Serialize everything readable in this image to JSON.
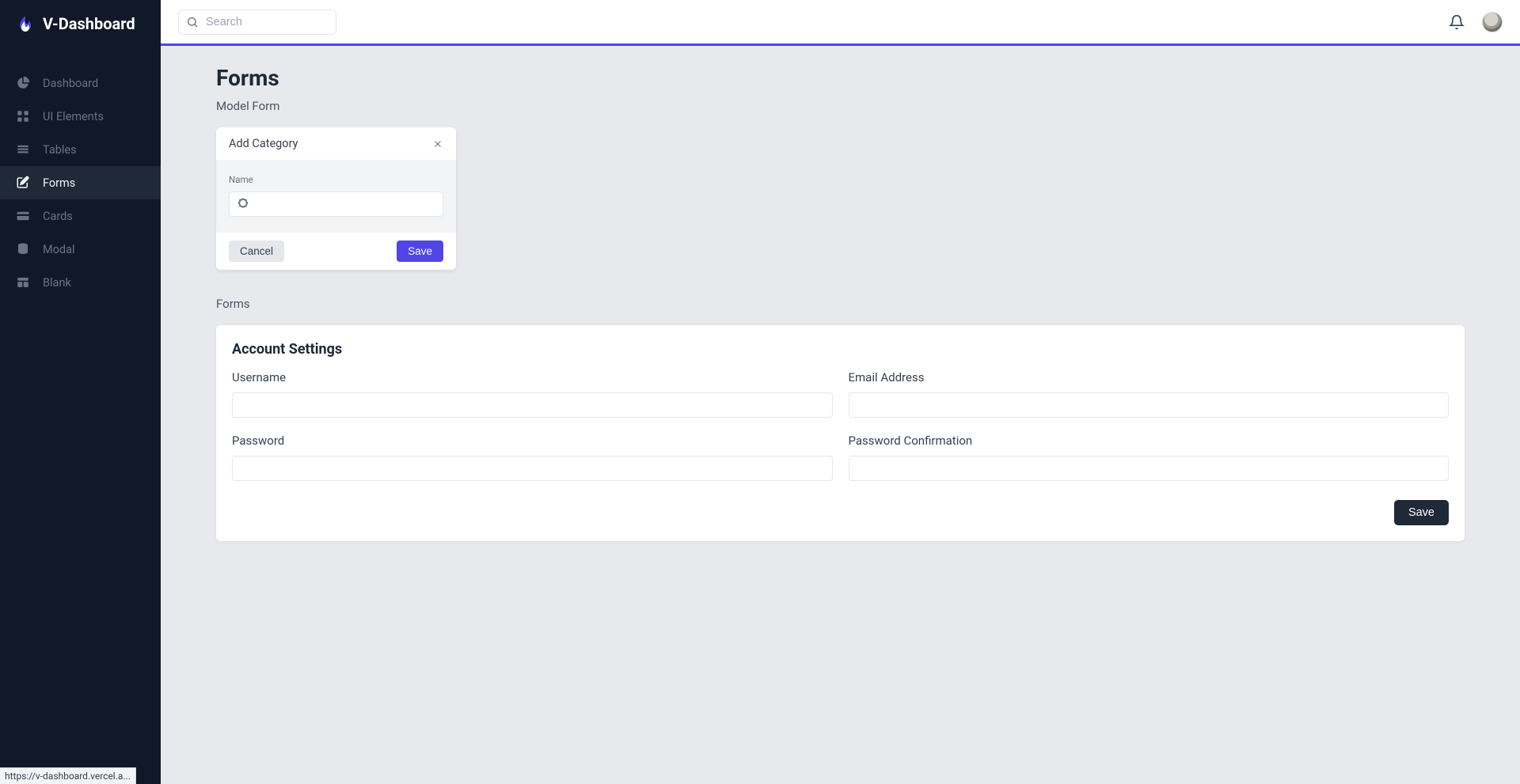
{
  "brand": {
    "title": "V-Dashboard"
  },
  "header": {
    "search_placeholder": "Search"
  },
  "sidebar": {
    "items": [
      {
        "label": "Dashboard"
      },
      {
        "label": "UI Elements"
      },
      {
        "label": "Tables"
      },
      {
        "label": "Forms"
      },
      {
        "label": "Cards"
      },
      {
        "label": "Modal"
      },
      {
        "label": "Blank"
      }
    ],
    "active_index": 3
  },
  "page": {
    "title": "Forms",
    "section_model_form": "Model Form",
    "section_forms": "Forms"
  },
  "modal": {
    "title": "Add Category",
    "name_label": "Name",
    "name_value": "",
    "cancel_label": "Cancel",
    "save_label": "Save"
  },
  "account_form": {
    "title": "Account Settings",
    "username_label": "Username",
    "username_value": "",
    "email_label": "Email Address",
    "email_value": "",
    "password_label": "Password",
    "password_value": "",
    "password_confirm_label": "Password Confirmation",
    "password_confirm_value": "",
    "save_label": "Save"
  },
  "status_hover_url": "https://v-dashboard.vercel.a..."
}
